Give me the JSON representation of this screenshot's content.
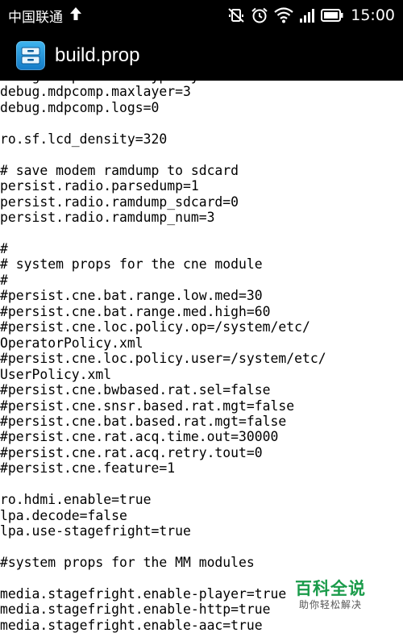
{
  "status_bar": {
    "carrier": "中国联通",
    "time": "15:00",
    "icons": [
      "upload-arrow-icon",
      "mute-icon",
      "alarm-icon",
      "wifi-icon",
      "signal-icon",
      "battery-icon"
    ]
  },
  "app_bar": {
    "title": "build.prop",
    "icon": "file-cabinet-icon"
  },
  "file_lines": [
    "debug.composition.type=dyn",
    "debug.mdpcomp.maxlayer=3",
    "debug.mdpcomp.logs=0",
    "",
    "ro.sf.lcd_density=320",
    "",
    "# save modem ramdump to sdcard",
    "persist.radio.parsedump=1",
    "persist.radio.ramdump_sdcard=0",
    "persist.radio.ramdump_num=3",
    "",
    "#",
    "# system props for the cne module",
    "#",
    "#persist.cne.bat.range.low.med=30",
    "#persist.cne.bat.range.med.high=60",
    "#persist.cne.loc.policy.op=/system/etc/",
    "OperatorPolicy.xml",
    "#persist.cne.loc.policy.user=/system/etc/",
    "UserPolicy.xml",
    "#persist.cne.bwbased.rat.sel=false",
    "#persist.cne.snsr.based.rat.mgt=false",
    "#persist.cne.bat.based.rat.mgt=false",
    "#persist.cne.rat.acq.time.out=30000",
    "#persist.cne.rat.acq.retry.tout=0",
    "#persist.cne.feature=1",
    "",
    "ro.hdmi.enable=true",
    "lpa.decode=false",
    "lpa.use-stagefright=true",
    "",
    "#system props for the MM modules",
    "",
    "media.stagefright.enable-player=true",
    "media.stagefright.enable-http=true",
    "media.stagefright.enable-aac=true"
  ],
  "watermark": {
    "main": "百科全说",
    "sub": "助你轻松解决"
  }
}
